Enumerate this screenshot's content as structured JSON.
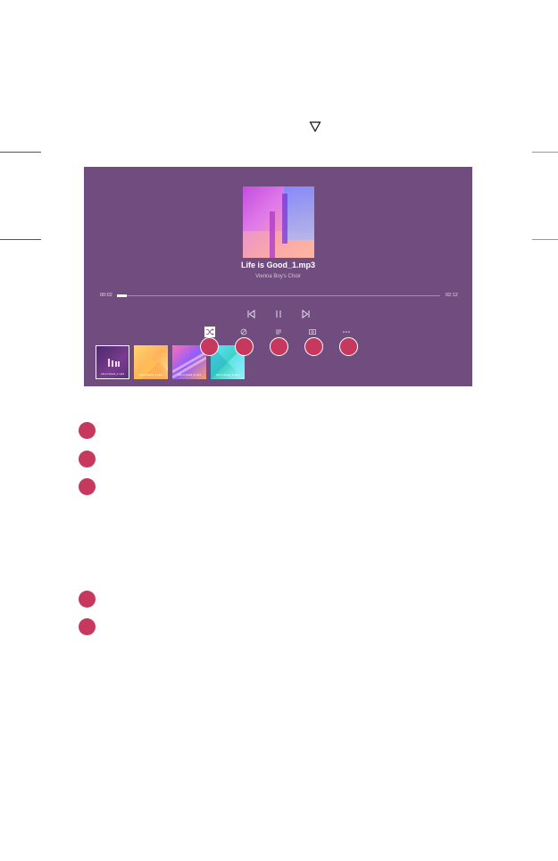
{
  "page_decoration": {
    "triangle_icon": "down-triangle-icon"
  },
  "player": {
    "background": "#714c7e",
    "song_title": "Life is Good_1.mp3",
    "artist": "Vienna Boy's Choir",
    "elapsed": "00:02",
    "total": "02:12",
    "progress_fraction": 0.03,
    "controls": [
      {
        "icon": "previous-icon"
      },
      {
        "icon": "pause-icon"
      },
      {
        "icon": "next-icon"
      }
    ],
    "options": [
      {
        "icon": "shuffle-icon",
        "selected": true
      },
      {
        "icon": "repeat-icon",
        "selected": false
      },
      {
        "icon": "lyrics-icon",
        "selected": false
      },
      {
        "icon": "screen-off-icon",
        "selected": false
      },
      {
        "icon": "more-icon",
        "selected": false
      }
    ],
    "playlist": [
      {
        "caption": "Life is Good_1.mp3"
      },
      {
        "caption": "Life is Good_2.mp3"
      },
      {
        "caption": "Life is Good_3.mp3"
      },
      {
        "caption": "Life is Good_4.mp3"
      }
    ]
  },
  "callout_color": "#c7385e"
}
